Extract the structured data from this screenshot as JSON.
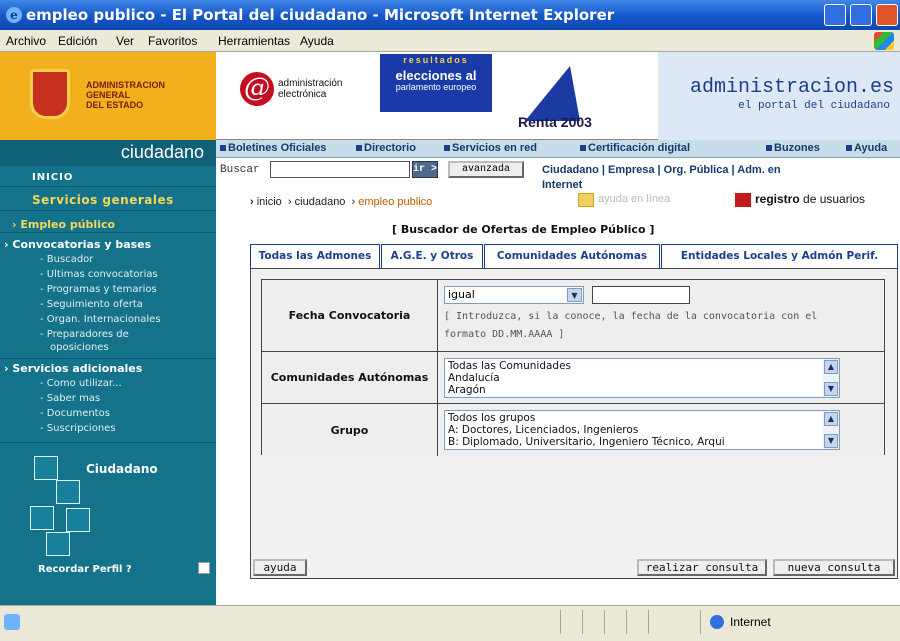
{
  "window": {
    "title": "empleo publico - El Portal del ciudadano - Microsoft Internet Explorer"
  },
  "menu": [
    "Archivo",
    "Edición",
    "Ver",
    "Favoritos",
    "Herramientas",
    "Ayuda"
  ],
  "header": {
    "admin_general": [
      "ADMINISTRACION",
      "GENERAL",
      "DEL ESTADO"
    ],
    "eadmin": "administración electrónica",
    "elecciones_top": "resultados",
    "elecciones_main": "elecciones al",
    "elecciones_sub": "parlamento europeo",
    "renta": "Renta 2003",
    "portal_big": "administracion.es",
    "portal_small": "el portal del ciudadano"
  },
  "sidebar": {
    "title": "ciudadano",
    "inicio": "INICIO",
    "servicios_generales": "Servicios generales",
    "empleo_publico": "Empleo público",
    "convocatorias": "Convocatorias y bases",
    "conv_items": [
      "Buscador",
      "Ultimas convocatorias",
      "Programas y temarios",
      "Seguimiento oferta",
      "Organ. Internacionales",
      "Preparadores de",
      "oposiciones"
    ],
    "servicios_adicionales": "Servicios adicionales",
    "adic_items": [
      "Como utilizar...",
      "Saber mas",
      "Documentos",
      "Suscripciones"
    ],
    "ciudadano_box": "Ciudadano",
    "recordar": "Recordar Perfil ?"
  },
  "nav": [
    "Boletines Oficiales",
    "Directorio",
    "Servicios en red",
    "Certificación digital",
    "Buzones",
    "Ayuda"
  ],
  "search": {
    "label": "Buscar",
    "value": "",
    "ir": "ir >",
    "avanzada": "avanzada",
    "toplinks": "Ciudadano | Empresa | Org. Pública | Adm. en",
    "toplinks2": "Internet"
  },
  "breadcrumb": {
    "a": "inicio",
    "b": "ciudadano",
    "c": "empleo publico"
  },
  "tools": {
    "ayuda": "ayuda en línea",
    "registro_bold": "registro",
    "registro_rest": " de usuarios"
  },
  "buscador": {
    "title": "[ Buscador de Ofertas de Empleo Público ]",
    "tabs": [
      "Todas las Admones",
      "A.G.E. y Otros",
      "Comunidades Autónomas",
      "Entidades Locales y Admón Perif."
    ],
    "fecha_label": "Fecha Convocatoria",
    "fecha_select": "igual",
    "fecha_hint": "[ Introduzca, si la conoce, la fecha de la convocatoria con el formato DD.MM.AAAA ]",
    "ccaa_label": "Comunidades Autónomas",
    "ccaa_options": [
      "Todas las Comunidades",
      "Andalucía",
      "Aragón"
    ],
    "grupo_label": "Grupo",
    "grupo_options": [
      "Todos los grupos",
      "A: Doctores, Licenciados, Ingenieros",
      "B: Diplomado, Universitario, Ingeniero Técnico, Arqui"
    ],
    "btn_ayuda": "ayuda",
    "btn_realizar": "realizar consulta",
    "btn_nueva": "nueva consulta"
  },
  "status": {
    "zone": "Internet"
  }
}
